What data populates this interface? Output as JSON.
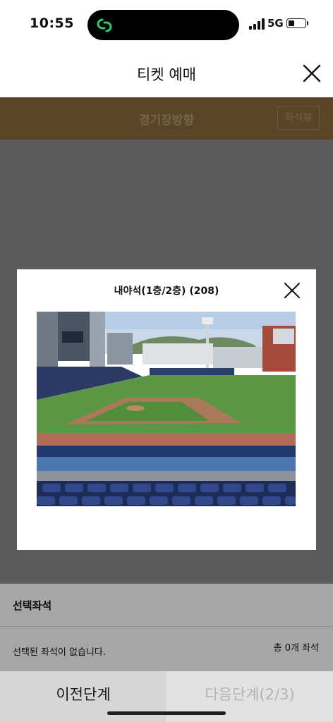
{
  "status_bar": {
    "time": "10:55",
    "network": "5G"
  },
  "header": {
    "title": "티켓 예매"
  },
  "stadium": {
    "label": "경기장방향",
    "seat_view_button": "좌석뷰"
  },
  "modal": {
    "title": "내야석(1층/2층) (208)"
  },
  "selected_panel": {
    "title": "선택좌석",
    "empty_message": "선택된 좌석이 없습니다.",
    "count_text": "총 0개 좌석"
  },
  "footer": {
    "prev_label": "이전단계",
    "next_label": "다음단계(2/3)"
  },
  "colors": {
    "stadium_bar": "#8a6a40",
    "overlay": "#8d8d8d",
    "disabled_text": "#b3b3b3"
  }
}
